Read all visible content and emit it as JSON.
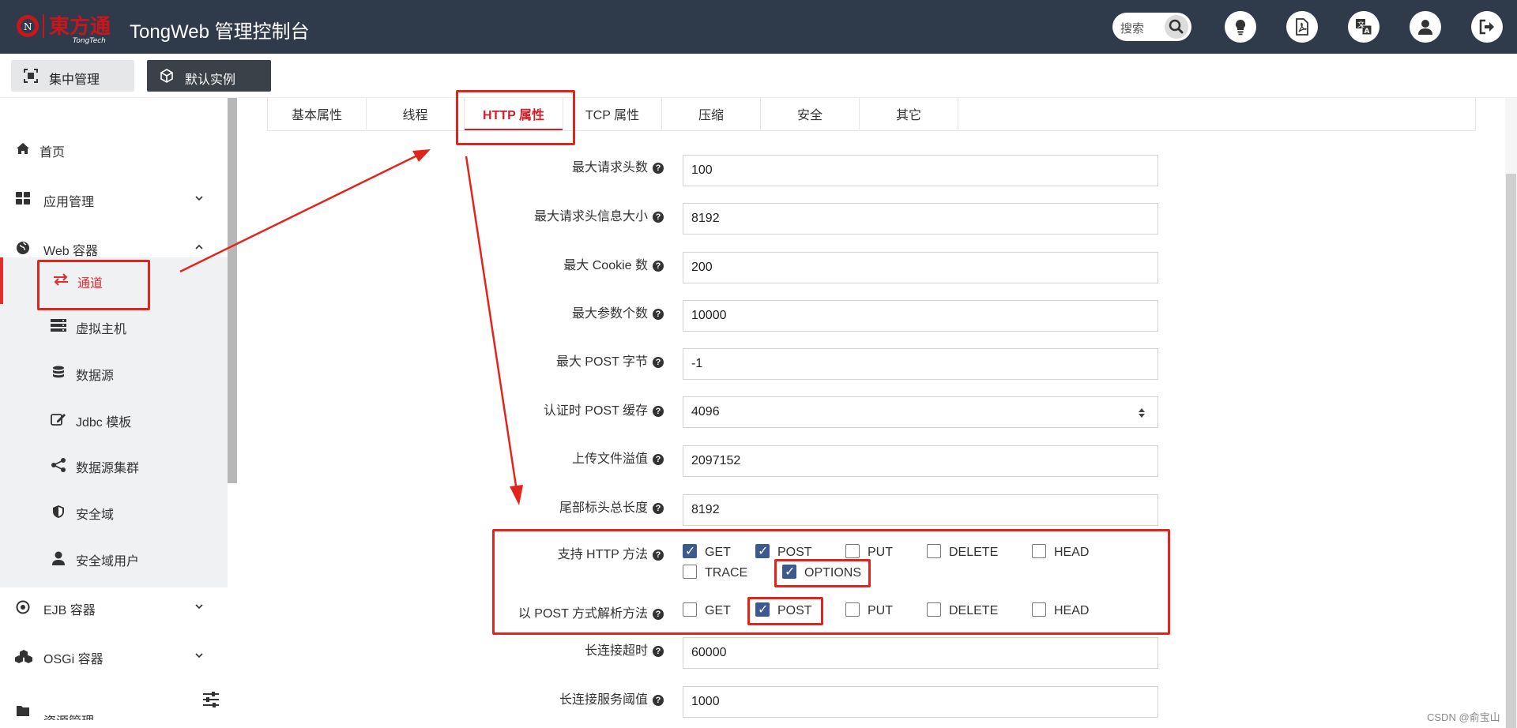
{
  "header": {
    "logo_text": "東方通",
    "logo_sub": "TongTech",
    "title": "TongWeb 管理控制台",
    "search_placeholder": "搜索",
    "icons": [
      "bulb-icon",
      "pdf-icon",
      "translate-icon",
      "user-icon",
      "logout-icon"
    ]
  },
  "toolbar": {
    "central_label": "集中管理",
    "instance_label": "默认实例"
  },
  "sidebar": {
    "items": [
      {
        "label": "首页",
        "icon": "home-icon"
      },
      {
        "label": "应用管理",
        "icon": "grid-icon"
      },
      {
        "label": "Web 容器",
        "icon": "globe-icon"
      },
      {
        "label": "通道",
        "icon": "exchange-icon"
      },
      {
        "label": "虚拟主机",
        "icon": "server-icon"
      },
      {
        "label": "数据源",
        "icon": "database-icon"
      },
      {
        "label": "Jdbc 模板",
        "icon": "edit-icon"
      },
      {
        "label": "数据源集群",
        "icon": "share-icon"
      },
      {
        "label": "安全域",
        "icon": "shield-icon"
      },
      {
        "label": "安全域用户",
        "icon": "user-icon"
      },
      {
        "label": "EJB 容器",
        "icon": "target-icon"
      },
      {
        "label": "OSGi 容器",
        "icon": "cubes-icon"
      },
      {
        "label": "资源管理",
        "icon": "folder-icon"
      }
    ]
  },
  "tabs": [
    "基本属性",
    "线程",
    "HTTP 属性",
    "TCP 属性",
    "压缩",
    "安全",
    "其它"
  ],
  "active_tab": "HTTP 属性",
  "form": {
    "fields": [
      {
        "label": "最大请求头数",
        "value": "100"
      },
      {
        "label": "最大请求头信息大小",
        "value": "8192"
      },
      {
        "label": "最大 Cookie 数",
        "value": "200"
      },
      {
        "label": "最大参数个数",
        "value": "10000"
      },
      {
        "label": "最大 POST 字节",
        "value": "-1"
      },
      {
        "label": "认证时 POST 缓存",
        "value": "4096"
      },
      {
        "label": "上传文件溢值",
        "value": "2097152"
      },
      {
        "label": "尾部标头总长度",
        "value": "8192"
      }
    ],
    "http_methods": {
      "label": "支持 HTTP 方法",
      "options": [
        {
          "label": "GET",
          "checked": true
        },
        {
          "label": "POST",
          "checked": true
        },
        {
          "label": "PUT",
          "checked": false
        },
        {
          "label": "DELETE",
          "checked": false
        },
        {
          "label": "HEAD",
          "checked": false
        },
        {
          "label": "TRACE",
          "checked": false
        },
        {
          "label": "OPTIONS",
          "checked": true
        }
      ]
    },
    "post_parse_methods": {
      "label": "以 POST 方式解析方法",
      "options": [
        {
          "label": "GET",
          "checked": false
        },
        {
          "label": "POST",
          "checked": true
        },
        {
          "label": "PUT",
          "checked": false
        },
        {
          "label": "DELETE",
          "checked": false
        },
        {
          "label": "HEAD",
          "checked": false
        }
      ]
    },
    "fields_after": [
      {
        "label": "长连接超时",
        "value": "60000"
      },
      {
        "label": "长连接服务阈值",
        "value": "1000"
      }
    ]
  },
  "watermark": "CSDN @俞宝山",
  "colors": {
    "header_bg": "#2f3a4b",
    "accent": "#d0202a",
    "annotation": "#e4231b",
    "checkbox": "#3d5a8e"
  }
}
